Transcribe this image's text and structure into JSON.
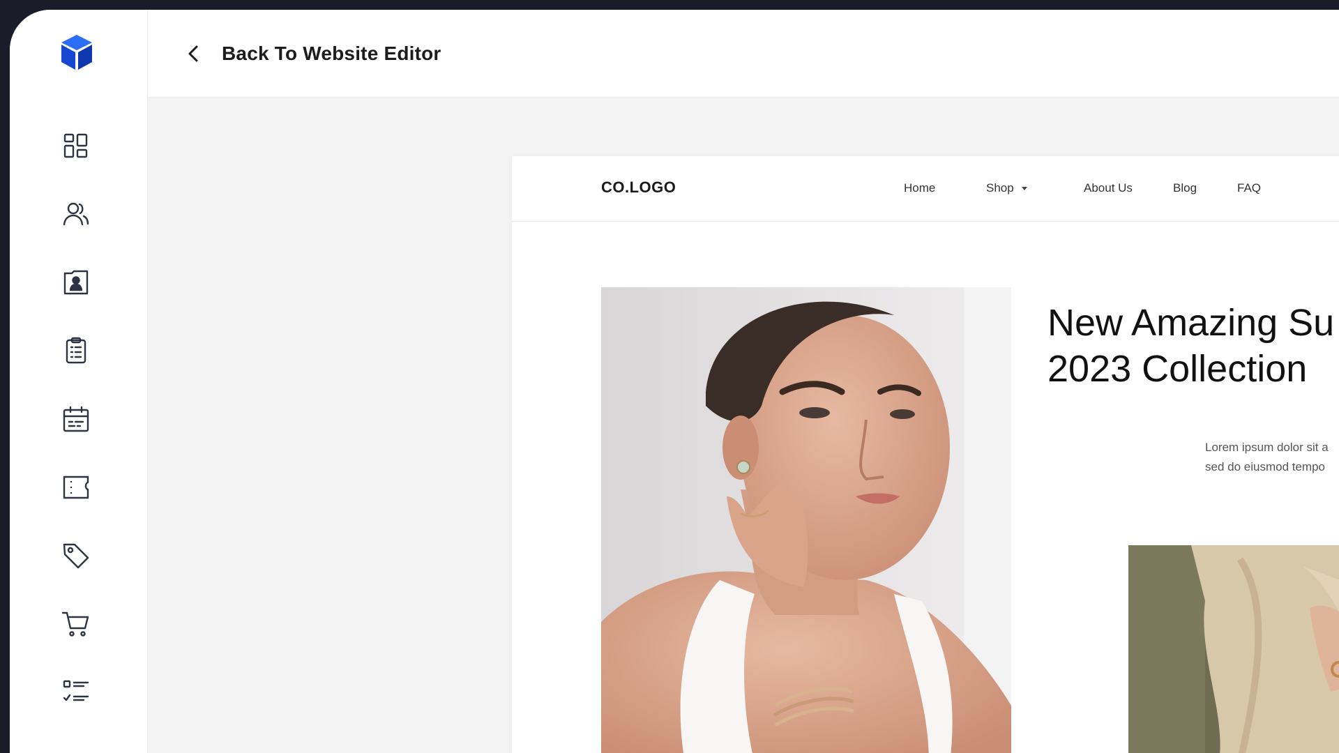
{
  "app": {
    "brand_icon": "cube-logo-icon",
    "accent": "#1547d1"
  },
  "sidebar": {
    "items": [
      {
        "icon": "dashboard-grid-icon"
      },
      {
        "icon": "users-icon"
      },
      {
        "icon": "contact-card-icon"
      },
      {
        "icon": "clipboard-list-icon"
      },
      {
        "icon": "calendar-icon"
      },
      {
        "icon": "ticket-icon"
      },
      {
        "icon": "tag-icon"
      },
      {
        "icon": "cart-icon"
      },
      {
        "icon": "checklist-icon"
      }
    ]
  },
  "topbar": {
    "back_label": "Back To Website Editor",
    "back_icon": "chevron-left-icon"
  },
  "preview": {
    "logo": "CO.LOGO",
    "nav": {
      "home": "Home",
      "shop": "Shop",
      "about": "About Us",
      "blog": "Blog",
      "faq": "FAQ"
    },
    "hero_title_line1": "New Amazing Su",
    "hero_title_line2": "2023 Collection",
    "hero_body_line1": "Lorem ipsum dolor sit a",
    "hero_body_line2": "sed do eiusmod tempo"
  }
}
